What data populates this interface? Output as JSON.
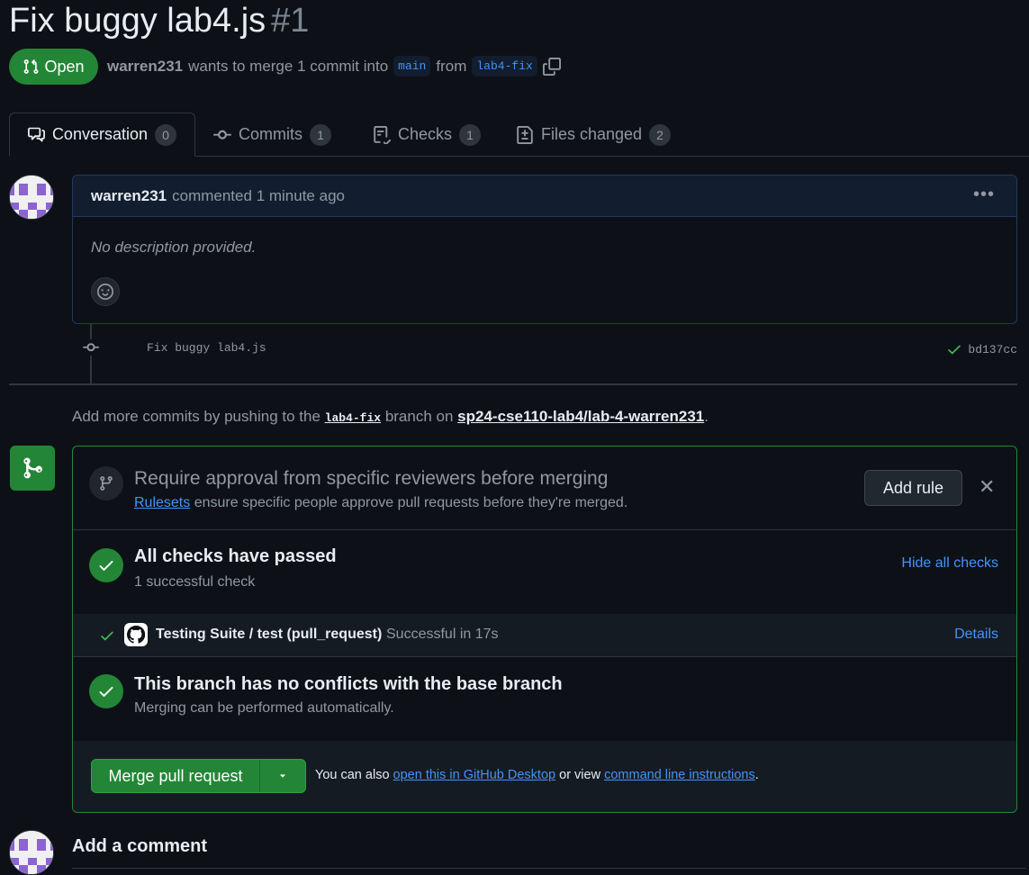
{
  "header": {
    "title": "Fix buggy lab4.js",
    "number": "#1",
    "state": "Open",
    "author": "warren231",
    "merge_text_1": "wants to merge 1 commit into",
    "base_branch": "main",
    "merge_text_2": "from",
    "head_branch": "lab4-fix"
  },
  "tabs": [
    {
      "label": "Conversation",
      "count": "0",
      "icon": "comment-discussion-icon"
    },
    {
      "label": "Commits",
      "count": "1",
      "icon": "git-commit-icon"
    },
    {
      "label": "Checks",
      "count": "1",
      "icon": "checklist-icon"
    },
    {
      "label": "Files changed",
      "count": "2",
      "icon": "file-diff-icon"
    }
  ],
  "comment": {
    "author": "warren231",
    "action": "commented",
    "time": "1 minute ago",
    "body": "No description provided."
  },
  "commit": {
    "message": "Fix buggy lab4.js",
    "sha": "bd137cc"
  },
  "hint": {
    "prefix": "Add more commits by pushing to the",
    "branch": "lab4-fix",
    "middle": "branch on",
    "repo": "sp24-cse110-lab4/lab-4-warren231",
    "suffix": "."
  },
  "rules": {
    "title": "Require approval from specific reviewers before merging",
    "link": "Rulesets",
    "subtitle": "ensure specific people approve pull requests before they're merged.",
    "add_rule": "Add rule"
  },
  "checks": {
    "title": "All checks have passed",
    "subtitle": "1 successful check",
    "hide_link": "Hide all checks",
    "items": [
      {
        "name": "Testing Suite / test (pull_request)",
        "status": "Successful in 17s",
        "details": "Details"
      }
    ]
  },
  "conflicts": {
    "title": "This branch has no conflicts with the base branch",
    "subtitle": "Merging can be performed automatically."
  },
  "merge": {
    "button": "Merge pull request",
    "text_1": "You can also",
    "link_1": "open this in GitHub Desktop",
    "text_2": "or view",
    "link_2": "command line instructions",
    "text_3": "."
  },
  "add_comment": {
    "heading": "Add a comment"
  },
  "colors": {
    "background": "#0d1117",
    "success": "#238636",
    "link": "#4493f8",
    "muted": "#9198a1"
  }
}
